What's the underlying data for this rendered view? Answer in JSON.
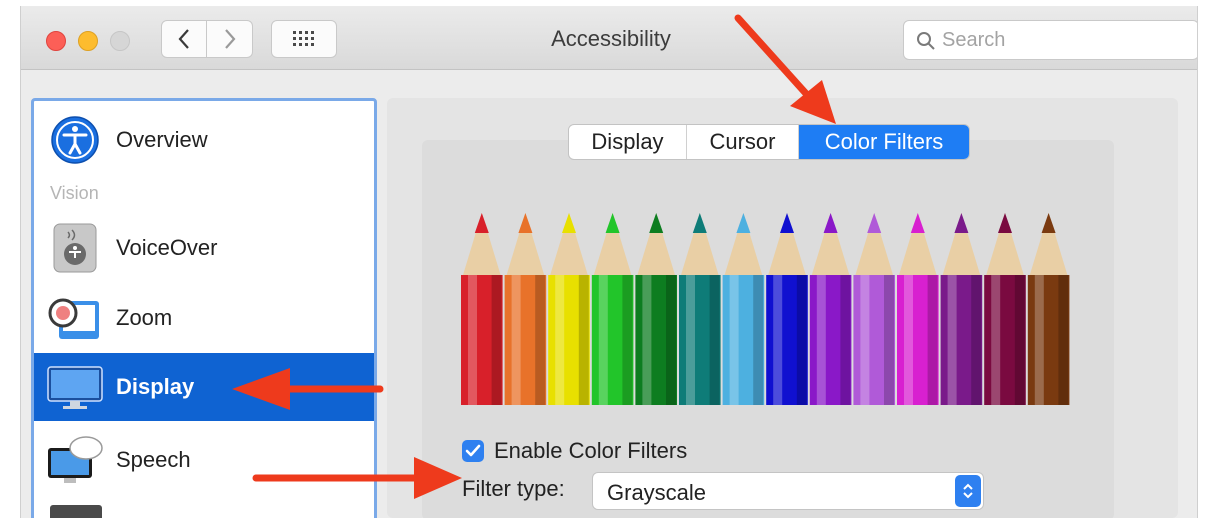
{
  "window": {
    "title": "Accessibility",
    "search_placeholder": "Search"
  },
  "sidebar": {
    "section_vision": "Vision",
    "items": [
      {
        "label": "Overview",
        "icon": "accessibility-icon"
      },
      {
        "label": "VoiceOver",
        "icon": "voiceover-icon"
      },
      {
        "label": "Zoom",
        "icon": "zoom-icon"
      },
      {
        "label": "Display",
        "icon": "display-icon",
        "selected": true
      },
      {
        "label": "Speech",
        "icon": "speech-icon"
      }
    ]
  },
  "tabs": [
    {
      "label": "Display"
    },
    {
      "label": "Cursor"
    },
    {
      "label": "Color Filters",
      "selected": true
    }
  ],
  "color_filters": {
    "enable_label": "Enable Color Filters",
    "enabled": true,
    "filter_type_label": "Filter type:",
    "filter_type_value": "Grayscale"
  },
  "pencil_colors": [
    "#d8202a",
    "#e8722a",
    "#e8e000",
    "#22c52a",
    "#0d7d20",
    "#0e7c78",
    "#4db0e0",
    "#1010d0",
    "#8a18c8",
    "#b05ad8",
    "#d820d0",
    "#7a1a8a",
    "#7a0a40",
    "#7a3a10"
  ],
  "colors": {
    "accent": "#1e7df4",
    "selection": "#0f63d2",
    "annotation_arrow": "#ee3a1c"
  }
}
